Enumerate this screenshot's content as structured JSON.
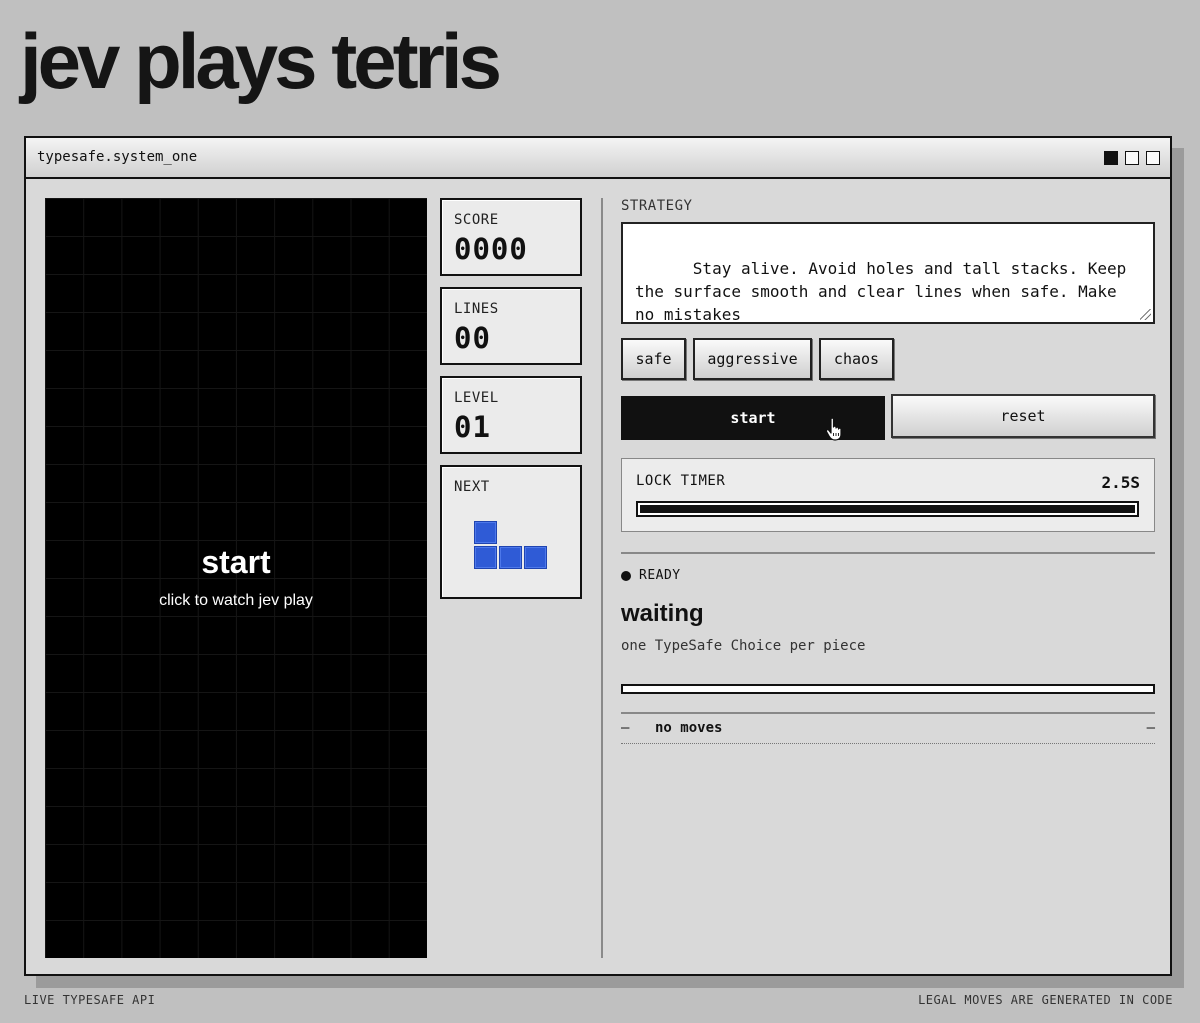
{
  "page": {
    "title": "jev plays tetris"
  },
  "window": {
    "title": "typesafe.system_one"
  },
  "board": {
    "start_label": "start",
    "subtitle": "click to watch jev play"
  },
  "stats": {
    "score": {
      "label": "SCORE",
      "value": "0000"
    },
    "lines": {
      "label": "LINES",
      "value": "00"
    },
    "level": {
      "label": "LEVEL",
      "value": "01"
    },
    "next": {
      "label": "NEXT",
      "piece": "J",
      "color": "#2f5bd6"
    }
  },
  "strategy": {
    "label": "STRATEGY",
    "value": "Stay alive. Avoid holes and tall stacks. Keep the surface smooth and clear lines when safe. Make no mistakes",
    "presets": [
      "safe",
      "aggressive",
      "chaos"
    ]
  },
  "controls": {
    "start_label": "start",
    "reset_label": "reset"
  },
  "lock_timer": {
    "label": "LOCK TIMER",
    "value": "2.5S",
    "fill_fraction": 1.0
  },
  "status": {
    "state": "READY",
    "headline": "waiting",
    "subtitle": "one TypeSafe Choice per piece",
    "progress_fraction": 0.0
  },
  "moves": {
    "dash_left": "–",
    "text": "no moves",
    "dash_right": "–"
  },
  "footer": {
    "left": "LIVE TYPESAFE API",
    "right": "LEGAL MOVES ARE GENERATED IN CODE"
  }
}
